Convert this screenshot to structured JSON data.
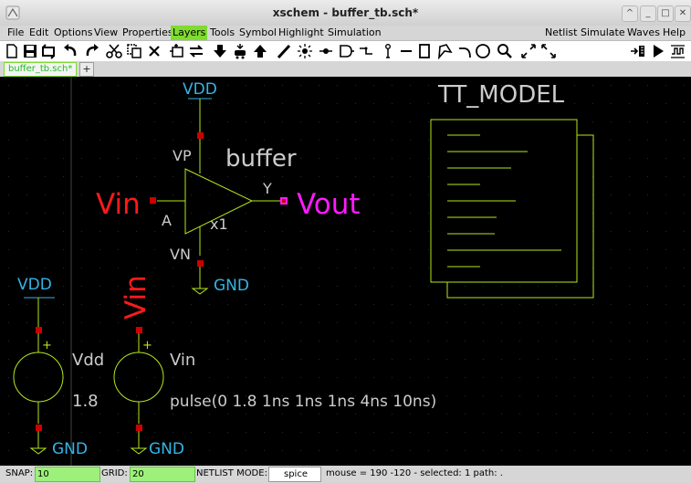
{
  "window": {
    "title": "xschem - buffer_tb.sch*"
  },
  "menubar": {
    "items": [
      {
        "label": "File"
      },
      {
        "label": "Edit"
      },
      {
        "label": "Options"
      },
      {
        "label": "View"
      },
      {
        "label": "Properties"
      },
      {
        "label": "Layers"
      },
      {
        "label": "Tools"
      },
      {
        "label": "Symbol"
      },
      {
        "label": "Highlight"
      },
      {
        "label": "Simulation"
      }
    ],
    "right_items": [
      {
        "label": "Netlist"
      },
      {
        "label": "Simulate"
      },
      {
        "label": "Waves"
      },
      {
        "label": "Help"
      }
    ],
    "highlighted": "Layers",
    "highlight_color": "#7fdb2f"
  },
  "toolbar": {
    "icons": [
      "new-icon",
      "save-icon",
      "reload-icon",
      "undo-icon",
      "redo-icon",
      "cut-icon",
      "copy-icon",
      "delete-icon",
      "insert-symbol-icon",
      "move-icon",
      "push-icon",
      "netlist-icon",
      "pop-icon",
      "wire-icon",
      "highlight-icon",
      "line-icon",
      "pin-icon",
      "rect-icon",
      "polygon-icon",
      "arc-icon",
      "circle-icon",
      "zoom-icon",
      "fullscreen-icon",
      "zoom-fit-icon",
      "netlist-run-icon",
      "simulate-icon",
      "waves-icon"
    ]
  },
  "tabs": {
    "active": "buffer_tb.sch*",
    "add_label": "+"
  },
  "schematic": {
    "colors": {
      "background": "#000000",
      "net_label": "#33b5e5",
      "symbol": "#b5e61d",
      "pin": "#cc0000",
      "text": "#cccccc",
      "vin": "#ff1a1a",
      "vout": "#ff1aff"
    },
    "labels": {
      "vdd_top": "VDD",
      "vp": "VP",
      "buffer_name": "buffer",
      "y": "Y",
      "vin_pin": "Vin",
      "a": "A",
      "x1": "x1",
      "vout": "Vout",
      "vn": "VN",
      "gnd_buf": "GND",
      "tt_model": "TT_MODEL",
      "vdd_src_top": "VDD",
      "vdd_src_name": "Vdd",
      "vdd_src_value": "1.8",
      "gnd_vdd": "GND",
      "vin_rot": "Vin",
      "vin_src_name": "Vin",
      "vin_src_value": "pulse(0 1.8 1ns 1ns 1ns 4ns 10ns)",
      "gnd_vin": "GND",
      "plus": "+"
    }
  },
  "status": {
    "snap_label": "SNAP:",
    "snap_value": "10",
    "grid_label": "GRID:",
    "grid_value": "20",
    "netlist_mode_label": "NETLIST MODE:",
    "netlist_mode_value": "spice",
    "info": "mouse = 190 -120 - selected: 1 path: ."
  }
}
